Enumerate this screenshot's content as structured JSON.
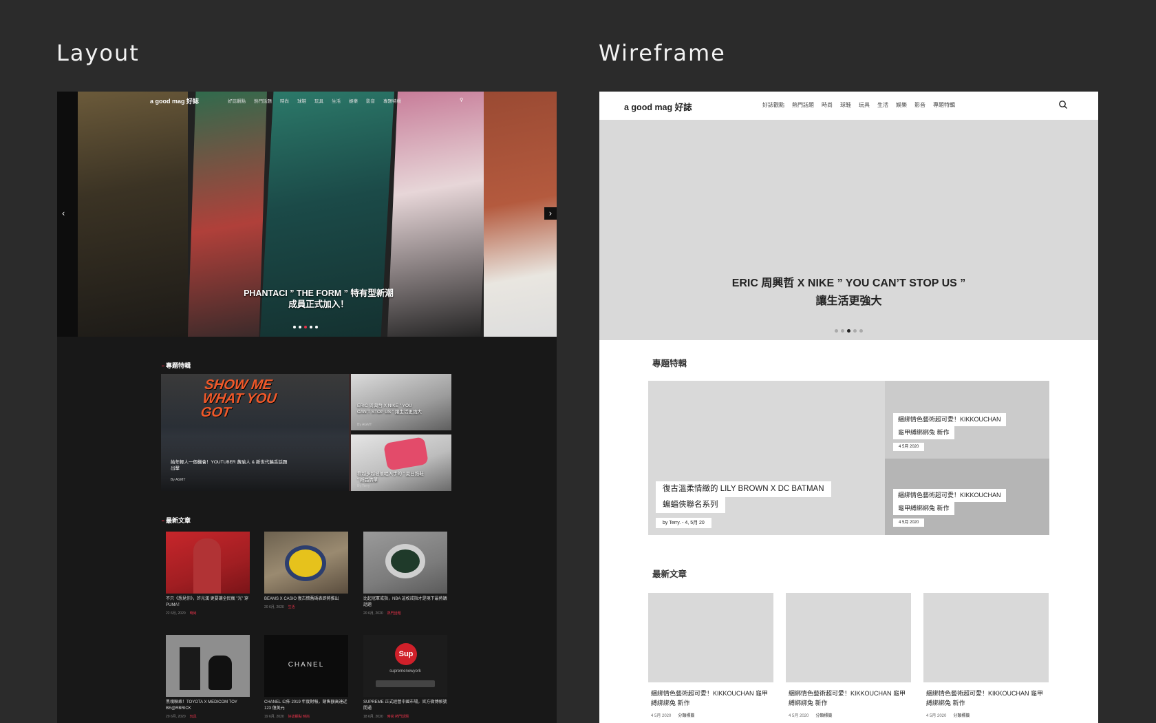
{
  "titles": {
    "layout": "Layout",
    "wireframe": "Wireframe"
  },
  "layout": {
    "logo": "a good mag 好誌",
    "nav": [
      "好誌觀點",
      "熱門話題",
      "時尚",
      "球鞋",
      "玩具",
      "生活",
      "娛樂",
      "影音",
      "專題特輯"
    ],
    "hero_caption_line1": "PHANTACI ” THE FORM ” 特有型新潮",
    "hero_caption_line2": "成員正式加入！",
    "hero_dots": 5,
    "hero_active_dot": 2,
    "featured_heading": "專題特輯",
    "featured_banner": "SHOW ME WHAT YOU GOT",
    "featured_big_caption": "給年輕人一個機會！YOUTUBER 黃瑜人 & 新世代饒舌話題出擊",
    "featured_big_by": "By AGMT",
    "featured_small": [
      {
        "caption": "ERIC 周興哲 X NIKE ” YOU CAN’T STOP US ” 讓生活更強大",
        "by": "By AGMT"
      },
      {
        "caption": "看越多越被催眠入手的 ” 夏日拖鞋 ” 新品清單",
        "by": "By Terry"
      }
    ],
    "latest_heading": "最新文章",
    "latest": [
      {
        "caption": "不只《想見你》，許光漢 更要讓全民瘋 ”光” 穿PUMA！",
        "date": "22 6月, 2020",
        "tag": "時尚"
      },
      {
        "caption": "BEAMS X CASIO 復古懷舊碼表即將推出",
        "date": "20 6月, 2020",
        "tag": "生活"
      },
      {
        "caption": "比起冠軍戒指，NBA 這枚戒指才是現下最熱議話題",
        "date": "20 6月, 2020",
        "tag": "熱門話題"
      },
      {
        "caption": "黑魂聯乘！TOYOTA X MEDICOM TOY BE@RBRICK",
        "date": "20 6月, 2020",
        "tag": "玩具"
      },
      {
        "caption": "CHANEL 公佈 2019 年度財報，銷售額高達近 123 億美元",
        "date": "19 6月, 2020",
        "tag": "好誌觀點 時尚"
      },
      {
        "caption": "SUPREME 正式經營中國市場，官方微博帳號開通",
        "date": "18 6月, 2020",
        "tag": "時尚 熱門話題"
      }
    ],
    "chanel_text": "CHANEL",
    "sup_text": "Sup",
    "sup_handle": "supremenewyork"
  },
  "wireframe": {
    "logo": "a good mag 好誌",
    "nav": [
      "好誌觀點",
      "熱門話題",
      "時尚",
      "球鞋",
      "玩具",
      "生活",
      "娛樂",
      "影音",
      "專題特輯"
    ],
    "hero_caption_line1": "ERIC 周興哲 X NIKE ” YOU CAN’T STOP US ”",
    "hero_caption_line2": "讓生活更強大",
    "featured_heading": "專題特輯",
    "featured_big_title_line1": "復古溫柔情緻的 LILY BROWN X DC BATMAN",
    "featured_big_title_line2": "蝙蝠俠聯名系列",
    "featured_big_meta": "by Terry. - 4, 5月 20",
    "featured_small": [
      {
        "title_line1": "綑綁情色藝術超可愛！KIKKOUCHAN",
        "title_line2": "龜甲縛綁綁兔 新作",
        "date": "4 5月 2020"
      },
      {
        "title_line1": "綑綁情色藝術超可愛！KIKKOUCHAN",
        "title_line2": "龜甲縛綁綁兔 新作",
        "date": "4 5月 2020"
      }
    ],
    "latest_heading": "最新文章",
    "latest": [
      {
        "caption": "綑綁情色藝術超可愛！KIKKOUCHAN 龜甲縛綁綁兔 新作",
        "date": "4 5月 2020",
        "tag": "分類標籤"
      },
      {
        "caption": "綑綁情色藝術超可愛！KIKKOUCHAN 龜甲縛綁綁兔 新作",
        "date": "4 5月 2020",
        "tag": "分類標籤"
      },
      {
        "caption": "綑綁情色藝術超可愛！KIKKOUCHAN 龜甲縛綁綁兔 新作",
        "date": "4 5月 2020",
        "tag": "分類標籤"
      }
    ]
  }
}
